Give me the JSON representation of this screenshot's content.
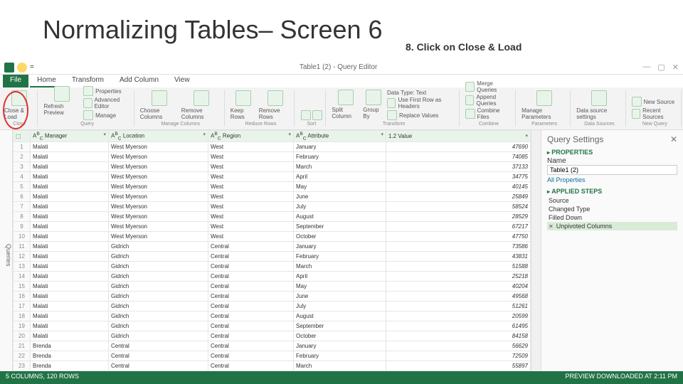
{
  "slide": {
    "title": "Normalizing Tables– Screen 6",
    "step": "8.  Click on Close & Load"
  },
  "titlebar": {
    "docname": "Table1 (2) - Query Editor"
  },
  "tabs": {
    "file": "File",
    "home": "Home",
    "transform": "Transform",
    "addcol": "Add Column",
    "view": "View"
  },
  "ribbon": {
    "close_load": "Close & Load",
    "close_grp": "Close",
    "refresh": "Refresh Preview",
    "props": "Properties",
    "adv": "Advanced Editor",
    "manage": "Manage",
    "query_grp": "Query",
    "choose": "Choose Columns",
    "remove": "Remove Columns",
    "cols_grp": "Manage Columns",
    "keep": "Keep Rows",
    "removerows": "Remove Rows",
    "rows_grp": "Reduce Rows",
    "sort_grp": "Sort",
    "split": "Split Column",
    "groupby": "Group By",
    "dtype": "Data Type: Text",
    "firstrow": "Use First Row as Headers",
    "replace": "Replace Values",
    "trans_grp": "Transform",
    "merge": "Merge Queries",
    "append": "Append Queries",
    "combinefiles": "Combine Files",
    "combine_grp": "Combine",
    "params": "Manage Parameters",
    "params_grp": "Parameters",
    "dsrc": "Data source settings",
    "dsrc_grp": "Data Sources",
    "newsrc": "New Source",
    "recent": "Recent Sources",
    "new_grp": "New Query"
  },
  "queries_tab": "Queries",
  "columns": {
    "c1": "Manager",
    "c2": "Location",
    "c3": "Region",
    "c4": "Attribute",
    "c5": "Value",
    "c5type": "1.2"
  },
  "rows": [
    {
      "n": "1",
      "m": "Malati",
      "l": "West Myerson",
      "r": "West",
      "a": "January",
      "v": "47690"
    },
    {
      "n": "2",
      "m": "Malati",
      "l": "West Myerson",
      "r": "West",
      "a": "February",
      "v": "74085"
    },
    {
      "n": "3",
      "m": "Malati",
      "l": "West Myerson",
      "r": "West",
      "a": "March",
      "v": "37133"
    },
    {
      "n": "4",
      "m": "Malati",
      "l": "West Myerson",
      "r": "West",
      "a": "April",
      "v": "34775"
    },
    {
      "n": "5",
      "m": "Malati",
      "l": "West Myerson",
      "r": "West",
      "a": "May",
      "v": "40145"
    },
    {
      "n": "6",
      "m": "Malati",
      "l": "West Myerson",
      "r": "West",
      "a": "June",
      "v": "25849"
    },
    {
      "n": "7",
      "m": "Malati",
      "l": "West Myerson",
      "r": "West",
      "a": "July",
      "v": "58524"
    },
    {
      "n": "8",
      "m": "Malati",
      "l": "West Myerson",
      "r": "West",
      "a": "August",
      "v": "28529"
    },
    {
      "n": "9",
      "m": "Malati",
      "l": "West Myerson",
      "r": "West",
      "a": "September",
      "v": "67217"
    },
    {
      "n": "10",
      "m": "Malati",
      "l": "West Myerson",
      "r": "West",
      "a": "October",
      "v": "47750"
    },
    {
      "n": "11",
      "m": "Malati",
      "l": "Gidrich",
      "r": "Central",
      "a": "January",
      "v": "73586"
    },
    {
      "n": "12",
      "m": "Malati",
      "l": "Gidrich",
      "r": "Central",
      "a": "February",
      "v": "43831"
    },
    {
      "n": "13",
      "m": "Malati",
      "l": "Gidrich",
      "r": "Central",
      "a": "March",
      "v": "51588"
    },
    {
      "n": "14",
      "m": "Malati",
      "l": "Gidrich",
      "r": "Central",
      "a": "April",
      "v": "25218"
    },
    {
      "n": "15",
      "m": "Malati",
      "l": "Gidrich",
      "r": "Central",
      "a": "May",
      "v": "40204"
    },
    {
      "n": "16",
      "m": "Malati",
      "l": "Gidrich",
      "r": "Central",
      "a": "June",
      "v": "49568"
    },
    {
      "n": "17",
      "m": "Malati",
      "l": "Gidrich",
      "r": "Central",
      "a": "July",
      "v": "51261"
    },
    {
      "n": "18",
      "m": "Malati",
      "l": "Gidrich",
      "r": "Central",
      "a": "August",
      "v": "20599"
    },
    {
      "n": "19",
      "m": "Malati",
      "l": "Gidrich",
      "r": "Central",
      "a": "September",
      "v": "61495"
    },
    {
      "n": "20",
      "m": "Malati",
      "l": "Gidrich",
      "r": "Central",
      "a": "October",
      "v": "84158"
    },
    {
      "n": "21",
      "m": "Brenda",
      "l": "Central",
      "r": "Central",
      "a": "January",
      "v": "56629"
    },
    {
      "n": "22",
      "m": "Brenda",
      "l": "Central",
      "r": "Central",
      "a": "February",
      "v": "72509"
    },
    {
      "n": "23",
      "m": "Brenda",
      "l": "Central",
      "r": "Central",
      "a": "March",
      "v": "55897"
    }
  ],
  "qs": {
    "title": "Query Settings",
    "props": "PROPERTIES",
    "name_lbl": "Name",
    "name_val": "Table1 (2)",
    "allprops": "All Properties",
    "applied": "APPLIED STEPS",
    "steps": [
      "Source",
      "Changed Type",
      "Filled Down",
      "Unpivoted Columns"
    ]
  },
  "status": {
    "left": "5 COLUMNS, 120 ROWS",
    "right": "PREVIEW DOWNLOADED AT 2:11 PM"
  }
}
